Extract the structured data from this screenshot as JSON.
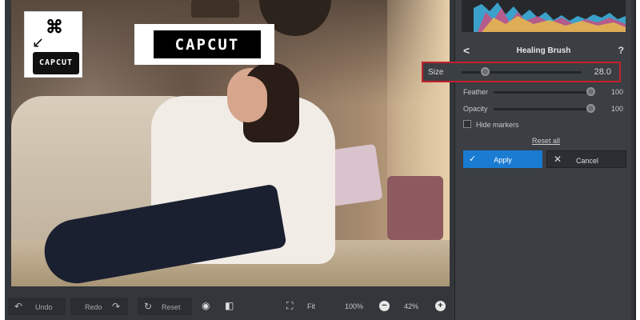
{
  "logo_small": {
    "text": "CAPCUT",
    "mark": "⌘",
    "arrow": "↙"
  },
  "logo_large": {
    "text": "CAPCUT"
  },
  "panel": {
    "title": "Healing Brush",
    "back": "<",
    "help": "?",
    "size": {
      "label": "Size",
      "value": "28.0",
      "level": 0.12
    },
    "feather": {
      "label": "Feather",
      "value": "100",
      "level": 1.0
    },
    "opacity": {
      "label": "Opacity",
      "value": "100",
      "level": 1.0
    },
    "hide_markers": {
      "label": "Hide markers",
      "checked": false
    },
    "reset_all": "Reset all",
    "apply": {
      "label": "Apply",
      "icon": "✓"
    },
    "cancel": {
      "label": "Cancel",
      "icon": "✕"
    }
  },
  "toolbar": {
    "undo": {
      "label": "Undo",
      "icon": "↶"
    },
    "redo": {
      "label": "Redo",
      "icon": "↷"
    },
    "reset": {
      "label": "Reset",
      "icon": "↻"
    },
    "fit": "Fit",
    "zoom_100": "100%",
    "zoom_current": "42%",
    "minus": "−",
    "plus": "+"
  }
}
